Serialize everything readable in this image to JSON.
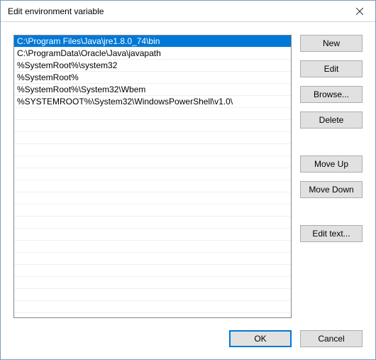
{
  "window": {
    "title": "Edit environment variable"
  },
  "list": {
    "items": [
      "C:\\Program Files\\Java\\jre1.8.0_74\\bin",
      "C:\\ProgramData\\Oracle\\Java\\javapath",
      "%SystemRoot%\\system32",
      "%SystemRoot%",
      "%SystemRoot%\\System32\\Wbem",
      "%SYSTEMROOT%\\System32\\WindowsPowerShell\\v1.0\\"
    ],
    "selected_index": 0
  },
  "buttons": {
    "new": "New",
    "edit": "Edit",
    "browse": "Browse...",
    "delete": "Delete",
    "move_up": "Move Up",
    "move_down": "Move Down",
    "edit_text": "Edit text...",
    "ok": "OK",
    "cancel": "Cancel"
  }
}
